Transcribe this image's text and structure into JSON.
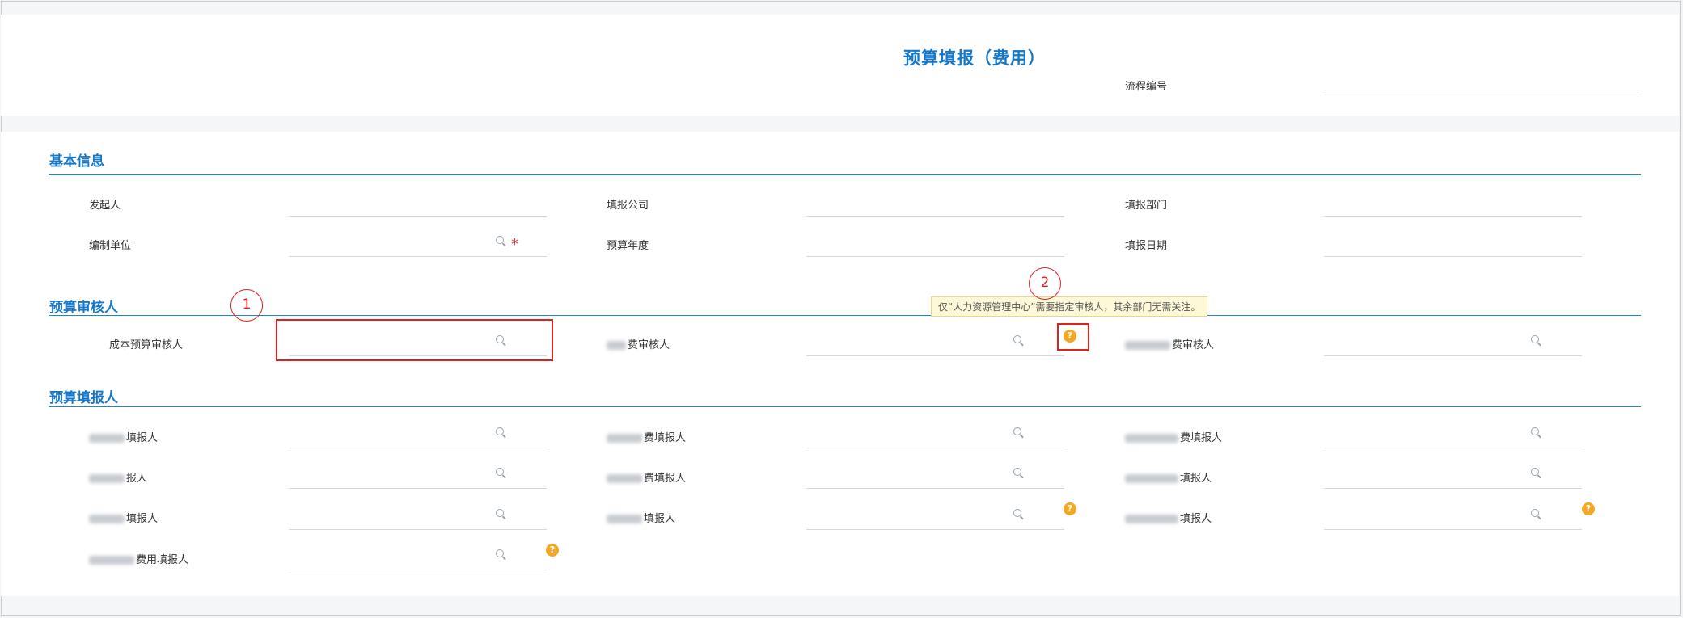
{
  "header": {
    "form_title": "预算填报（费用）",
    "process_no_label": "流程编号",
    "process_no_value": ""
  },
  "sections": {
    "basic_info": {
      "title": "基本信息",
      "fields": {
        "initiator": {
          "label": "发起人",
          "value": ""
        },
        "company": {
          "label": "填报公司",
          "value": ""
        },
        "department": {
          "label": "填报部门",
          "value": ""
        },
        "unit": {
          "label": "编制单位",
          "value": "",
          "required": true
        },
        "year": {
          "label": "预算年度",
          "value": ""
        },
        "date": {
          "label": "填报日期",
          "value": ""
        }
      }
    },
    "reviewers": {
      "title": "预算审核人",
      "fields": {
        "cost_reviewer": {
          "label": "成本预算审核人",
          "value": ""
        },
        "fee_reviewer_1": {
          "label": "费审核人",
          "value": ""
        },
        "fee_reviewer_2": {
          "label": "费审核人",
          "value": ""
        }
      },
      "tooltip": "仅“人力资源管理中心”需要指定审核人，其余部门无需关注。"
    },
    "fillers": {
      "title": "预算填报人",
      "fields": {
        "f1": {
          "label": "填报人",
          "value": ""
        },
        "f2": {
          "label": "费填报人",
          "value": ""
        },
        "f3": {
          "label": "费填报人",
          "value": ""
        },
        "f4": {
          "label": "报人",
          "value": ""
        },
        "f5": {
          "label": "费填报人",
          "value": ""
        },
        "f6": {
          "label": "填报人",
          "value": ""
        },
        "f7": {
          "label": "填报人",
          "value": ""
        },
        "f8": {
          "label": "填报人",
          "value": ""
        },
        "f9": {
          "label": "填报人",
          "value": ""
        },
        "f10": {
          "label": "费用填报人",
          "value": ""
        }
      }
    }
  },
  "annotations": {
    "callout_1": "1",
    "callout_2": "2"
  },
  "icons": {
    "search": "search-icon",
    "help": "help-icon",
    "help_glyph": "?",
    "required_glyph": "*"
  },
  "colors": {
    "title_blue": "#1477c9",
    "section_line": "#1d86d6",
    "help_orange": "#f5a623",
    "callout_red": "#e02020",
    "required_red": "#e03c3c"
  }
}
